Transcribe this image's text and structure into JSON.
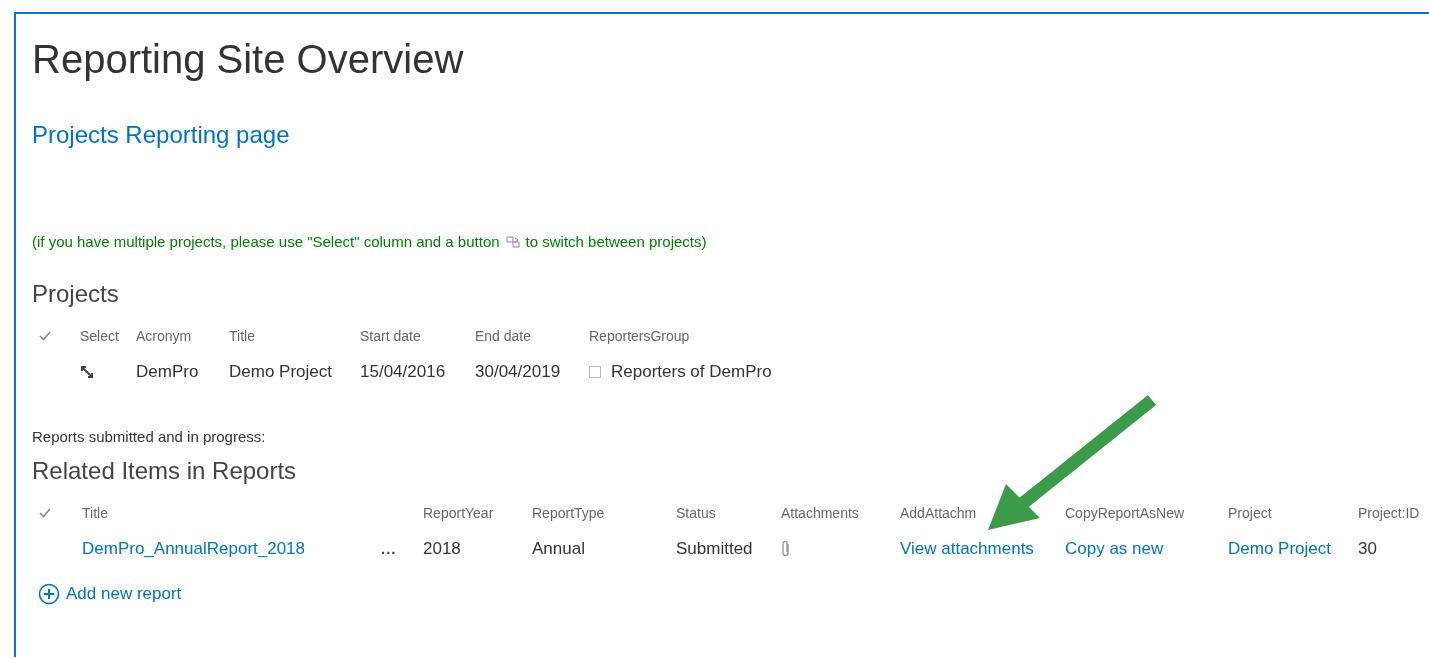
{
  "page": {
    "title": "Reporting Site Overview",
    "link": "Projects Reporting page",
    "hint_start": "(if you have multiple projects, please use \"Select\" column and a button",
    "hint_end": "to switch between projects)"
  },
  "projects": {
    "heading": "Projects",
    "columns": [
      "Select",
      "Acronym",
      "Title",
      "Start date",
      "End date",
      "ReportersGroup"
    ],
    "rows": [
      {
        "cells": [
          {
            "kind": "select"
          },
          {
            "kind": "text",
            "text": "DemPro"
          },
          {
            "kind": "text",
            "text": "Demo Project"
          },
          {
            "kind": "text",
            "text": "15/04/2016"
          },
          {
            "kind": "text",
            "text": "30/04/2019"
          },
          {
            "kind": "presence",
            "text": "Reporters of DemPro"
          }
        ]
      }
    ]
  },
  "reports": {
    "intro": "Reports submitted and in progress:",
    "heading": "Related Items in Reports",
    "columns": [
      "Title",
      "",
      "ReportYear",
      "ReportType",
      "Status",
      "Attachments",
      "AddAttachm",
      "CopyReportAsNew",
      "Project",
      "Project:ID"
    ],
    "rows": [
      {
        "cells": [
          {
            "kind": "link",
            "text": "DemPro_AnnualReport_2018"
          },
          {
            "kind": "menu",
            "text": "..."
          },
          {
            "kind": "text",
            "text": "2018"
          },
          {
            "kind": "text",
            "text": "Annual"
          },
          {
            "kind": "text",
            "text": "Submitted"
          },
          {
            "kind": "attachment"
          },
          {
            "kind": "link",
            "text": "View attachments"
          },
          {
            "kind": "link",
            "text": "Copy as new"
          },
          {
            "kind": "link",
            "text": "Demo Project"
          },
          {
            "kind": "text",
            "text": "30"
          }
        ]
      }
    ],
    "add_link": "Add new report"
  }
}
